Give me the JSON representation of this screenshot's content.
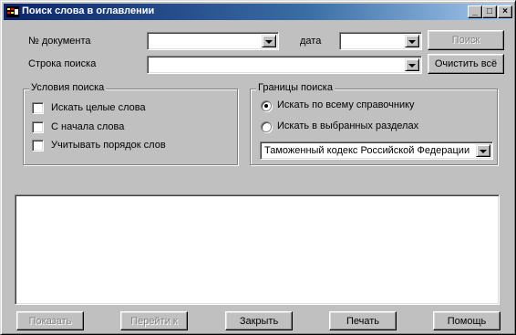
{
  "window": {
    "title": "Поиск слова в оглавлении",
    "minimize_glyph": "_",
    "maximize_glyph": "□",
    "close_glyph": "×"
  },
  "form": {
    "doc_number_label": "№ документа",
    "doc_number_value": "",
    "date_label": "дата",
    "date_value": "",
    "search_string_label": "Строка поиска",
    "search_string_value": ""
  },
  "buttons": {
    "search": "Поиск",
    "clear_all": "Очистить всё",
    "show": "Показать",
    "go_to": "Перейти к",
    "close": "Закрыть",
    "print": "Печать",
    "help": "Помощь"
  },
  "search_conditions": {
    "title": "Условия поиска",
    "options": [
      {
        "label": "Искать целые слова",
        "checked": false
      },
      {
        "label": "С начала слова",
        "checked": false
      },
      {
        "label": "Учитывать порядок слов",
        "checked": false
      }
    ]
  },
  "search_scope": {
    "title": "Границы поиска",
    "options": [
      {
        "label": "Искать по всему справочнику",
        "selected": true
      },
      {
        "label": "Искать в выбранных разделах",
        "selected": false
      }
    ],
    "section_select_value": "Таможенный кодекс Российской Федерации"
  },
  "results": {
    "items": []
  },
  "colors": {
    "face": "#c0c0c0",
    "title_start": "#0a246a",
    "title_end": "#a6caf0",
    "disabled_text": "#808080"
  }
}
